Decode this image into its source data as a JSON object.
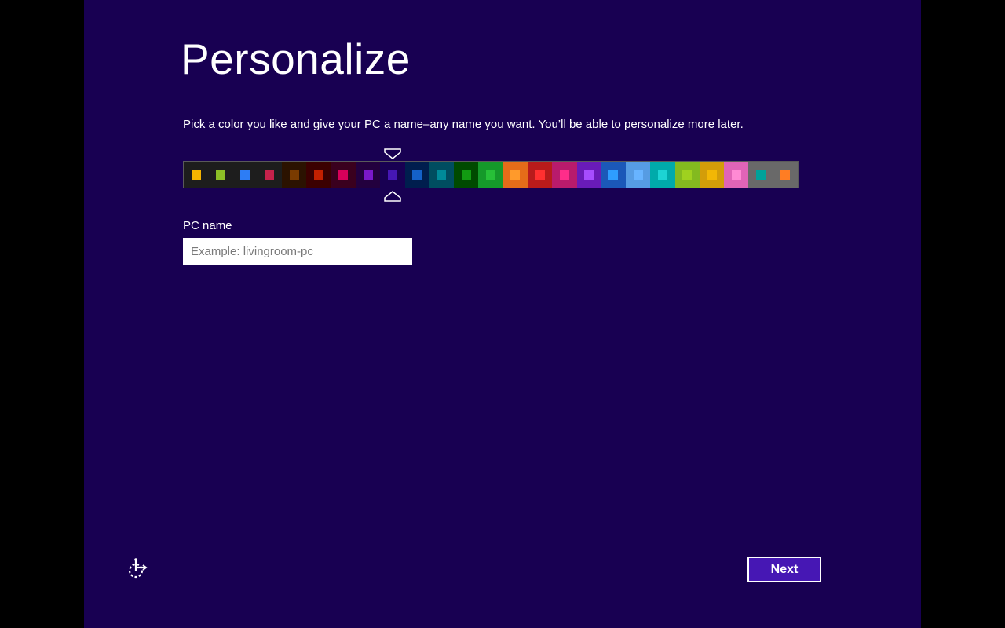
{
  "page": {
    "title": "Personalize",
    "subtitle": "Pick a color you like and give your PC a name–any name you want. You’ll be able to personalize more later."
  },
  "colors": {
    "background": "#180052",
    "accent_button": "#4617b4",
    "selected_index": 8,
    "swatches": [
      {
        "bg": "#1d1d1d",
        "chip": "#f4b400"
      },
      {
        "bg": "#1d1d1d",
        "chip": "#8cbf26"
      },
      {
        "bg": "#1d1d1d",
        "chip": "#2d7df5"
      },
      {
        "bg": "#1d1d1d",
        "chip": "#c4224b"
      },
      {
        "bg": "#2b1200",
        "chip": "#7a3b00"
      },
      {
        "bg": "#3b0000",
        "chip": "#c32000"
      },
      {
        "bg": "#3a001e",
        "chip": "#d8005a"
      },
      {
        "bg": "#23003e",
        "chip": "#7a18c8"
      },
      {
        "bg": "#180052",
        "chip": "#4617b4"
      },
      {
        "bg": "#001e4e",
        "chip": "#1461c8"
      },
      {
        "bg": "#004d60",
        "chip": "#008a99"
      },
      {
        "bg": "#004a00",
        "chip": "#129a12"
      },
      {
        "bg": "#15992a",
        "chip": "#27c038"
      },
      {
        "bg": "#e56c19",
        "chip": "#ff9a2b"
      },
      {
        "bg": "#b81b1b",
        "chip": "#ff3030"
      },
      {
        "bg": "#b81b6c",
        "chip": "#ff2d8a"
      },
      {
        "bg": "#691bb8",
        "chip": "#a64dff"
      },
      {
        "bg": "#1b58b8",
        "chip": "#2e9dff"
      },
      {
        "bg": "#569ce3",
        "chip": "#68b4ff"
      },
      {
        "bg": "#00aaaa",
        "chip": "#1dd4d4"
      },
      {
        "bg": "#83ba1f",
        "chip": "#9fd11f"
      },
      {
        "bg": "#d39d09",
        "chip": "#f2b705"
      },
      {
        "bg": "#e064b7",
        "chip": "#ff8ad4"
      },
      {
        "bg": "#696969",
        "chip": "#00a29a"
      },
      {
        "bg": "#696969",
        "chip": "#ff7d23"
      }
    ]
  },
  "pc_name": {
    "label": "PC name",
    "value": "",
    "placeholder": "Example: livingroom-pc"
  },
  "footer": {
    "ease_of_access_icon": "ease-of-access-icon",
    "next_label": "Next"
  }
}
